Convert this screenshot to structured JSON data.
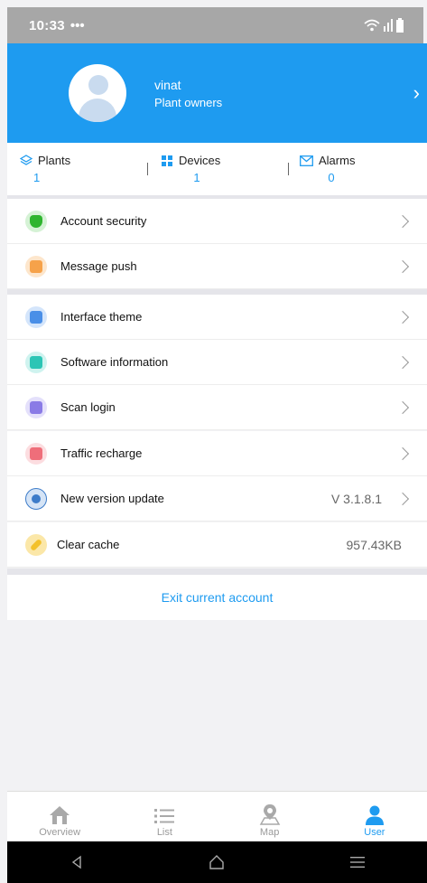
{
  "status_bar": {
    "time": "10:33",
    "dots": "•••"
  },
  "profile": {
    "name": "vinat",
    "role": "Plant owners"
  },
  "stats": [
    {
      "label": "Plants",
      "value": "1"
    },
    {
      "label": "Devices",
      "value": "1"
    },
    {
      "label": "Alarms",
      "value": "0"
    }
  ],
  "menu": {
    "account_security": "Account security",
    "message_push": "Message push",
    "interface_theme": "Interface theme",
    "software_information": "Software information",
    "scan_login": "Scan login",
    "traffic_recharge": "Traffic recharge",
    "new_version_update": "New version update",
    "version_value": "V 3.1.8.1",
    "clear_cache": "Clear cache",
    "cache_value": "957.43KB"
  },
  "exit_label": "Exit current account",
  "tabs": [
    {
      "label": "Overview"
    },
    {
      "label": "List"
    },
    {
      "label": "Map"
    },
    {
      "label": "User"
    }
  ],
  "colors": {
    "accent": "#1e9bf0",
    "security": "#2fb52f",
    "message": "#f6a24a",
    "theme": "#4a8fe7",
    "software": "#2dc5b5",
    "scan": "#8a7be6",
    "traffic": "#ef6e7a",
    "update": "#3d7cc9",
    "cache": "#f3c12a"
  }
}
